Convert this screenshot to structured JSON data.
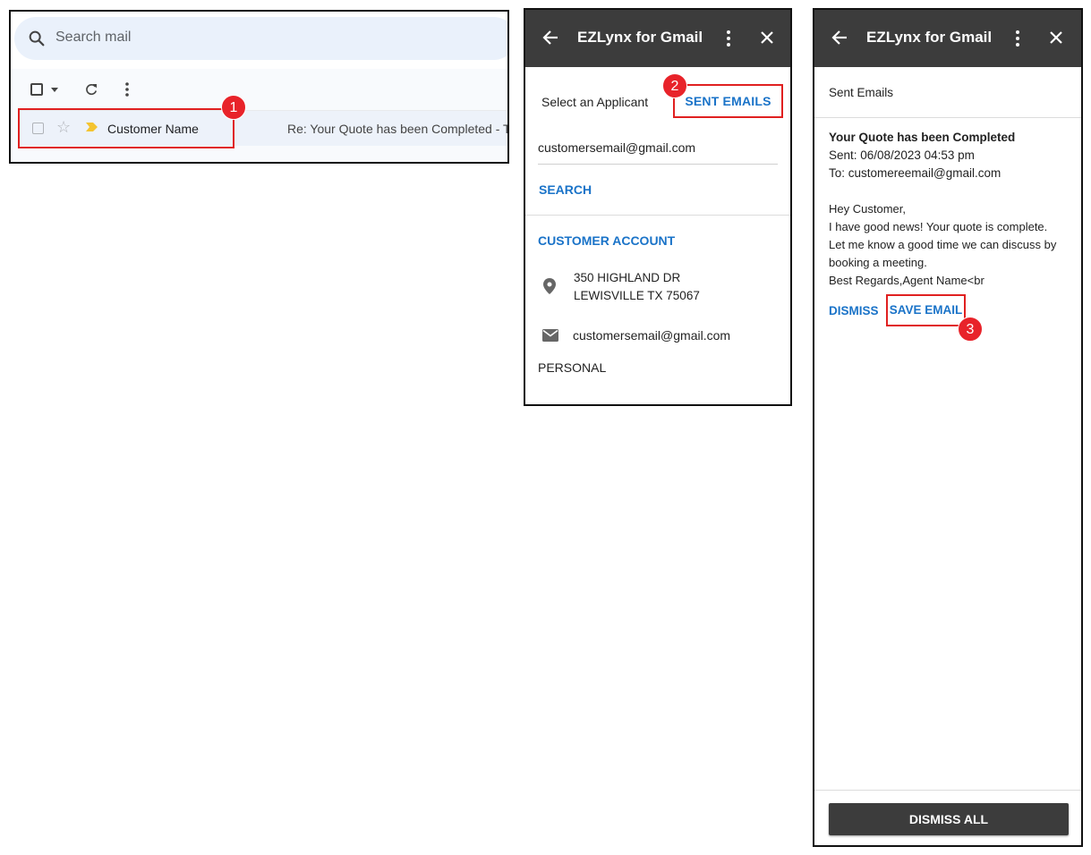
{
  "gmail": {
    "search_placeholder": "Search mail",
    "email_row": {
      "sender": "Customer Name",
      "subject": "Re: Your Quote has been Completed - T"
    },
    "step_badge": "1"
  },
  "addon_panel": {
    "header_title": "EZLynx for Gmail",
    "select_applicant_label": "Select an Applicant",
    "sent_emails_button": "SENT EMAILS",
    "step_badge": "2",
    "email_input_value": "customersemail@gmail.com",
    "search_button": "SEARCH",
    "customer_account_label": "CUSTOMER ACCOUNT",
    "address_line1": "350 HIGHLAND DR",
    "address_line2": "LEWISVILLE TX 75067",
    "customer_email": "customersemail@gmail.com",
    "account_type": "PERSONAL"
  },
  "sent_emails_panel": {
    "header_title": "EZLynx for Gmail",
    "section_title": "Sent Emails",
    "email": {
      "subject": "Your Quote has been Completed",
      "sent": "Sent: 06/08/2023 04:53 pm",
      "to": "To:  customereemail@gmail.com",
      "body_lines": [
        "Hey Customer,",
        "I have good news! Your quote is complete.",
        "Let me know a good time we can discuss by",
        "booking a meeting.",
        "Best Regards,Agent Name<br"
      ]
    },
    "dismiss_button": "DISMISS",
    "save_email_button": "SAVE EMAIL",
    "step_badge": "3",
    "dismiss_all_button": "DISMISS ALL"
  },
  "colors": {
    "accent_blue": "#1a73c8",
    "highlight_red": "#e02020",
    "header_dark": "#3c3c3c",
    "gmail_search_bg": "#eaf1fb",
    "important_marker": "#f4c430"
  },
  "icons": [
    "search-icon",
    "refresh-icon",
    "more-vert-icon",
    "star-icon",
    "important-marker-icon",
    "back-arrow-icon",
    "close-icon",
    "location-pin-icon",
    "mail-icon",
    "chevron-down-icon"
  ]
}
